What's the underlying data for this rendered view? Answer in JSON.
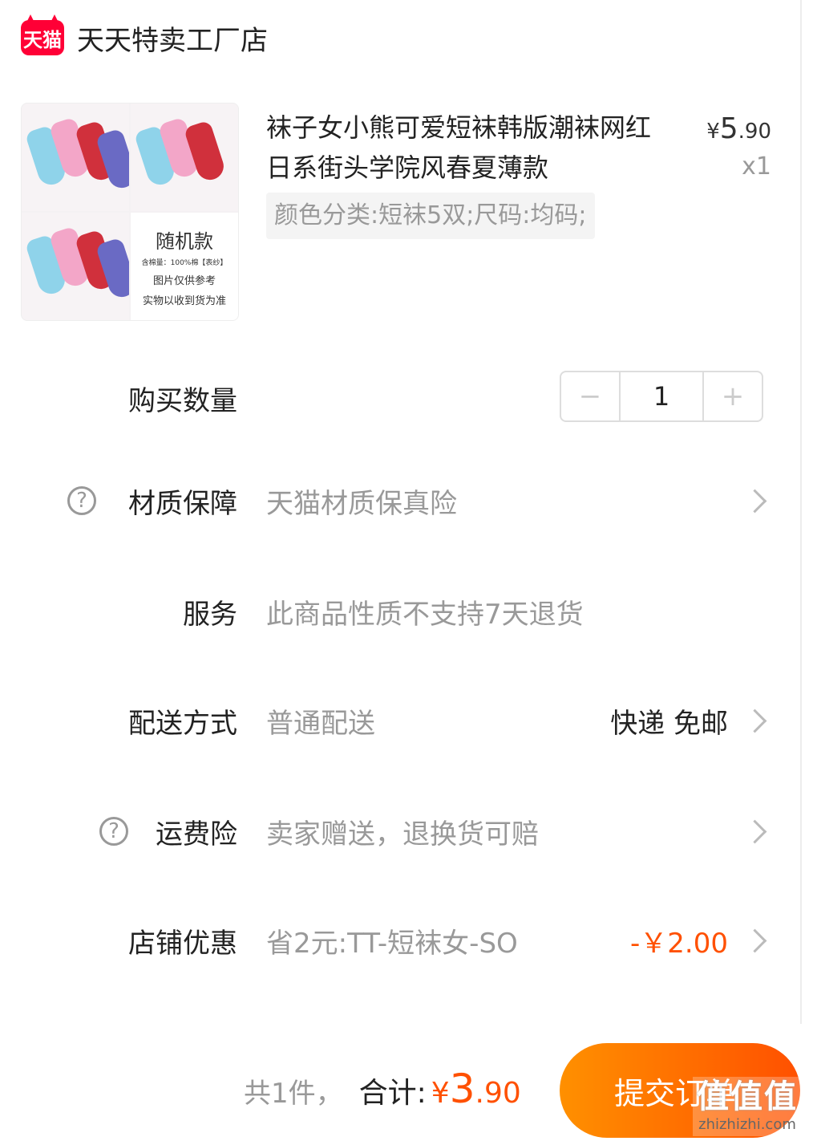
{
  "shop": {
    "badge": "天猫",
    "name": "天天特卖工厂店"
  },
  "product": {
    "image_note": {
      "line1": "随机款",
      "line2": "含棉量：100%棉【表纱】",
      "line3": "图片仅供参考",
      "line4": "实物以收到货为准"
    },
    "title": "袜子女小熊可爱短袜韩版潮袜网红日系街头学院风春夏薄款",
    "price": {
      "yen": "¥",
      "int": "5",
      "dec": ".90"
    },
    "qty": "x1",
    "sku": "颜色分类:短袜5双;尺码:均码;"
  },
  "quantity_row": {
    "label": "购买数量",
    "minus": "−",
    "value": "1",
    "plus": "+"
  },
  "material_row": {
    "label": "材质保障",
    "value": "天猫材质保真险"
  },
  "service_row": {
    "label": "服务",
    "value": "此商品性质不支持7天退货"
  },
  "delivery_row": {
    "label": "配送方式",
    "value": "普通配送",
    "right": "快递 免邮"
  },
  "shipping_insurance_row": {
    "label": "运费险",
    "value": "卖家赠送，退换货可赔"
  },
  "discount_row": {
    "label": "店铺优惠",
    "value": "省2元:TT-短袜女-SO",
    "right": "-￥2.00"
  },
  "bottom": {
    "count": "共1件，",
    "total_label": "合计:",
    "total_yen": "¥",
    "total_int": "3",
    "total_dec": ".90",
    "submit": "提交订单"
  },
  "watermark": {
    "logo": "值值值",
    "url": "zhizhizhi.com"
  },
  "icons": {
    "help": "?",
    "chevron": "chevron-right"
  },
  "colors": {
    "accent": "#ff5000",
    "tmall_red": "#ff0036",
    "muted": "#999999"
  }
}
